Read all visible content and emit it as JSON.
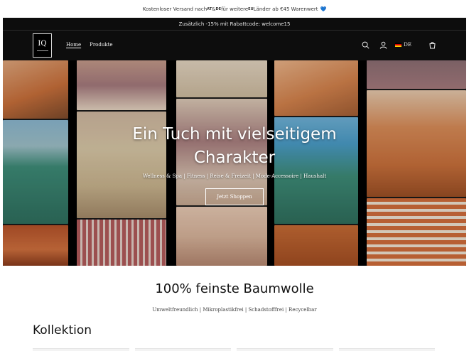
{
  "announcement": {
    "text_before": "Kostenloser Versand nach ",
    "country": "AT",
    "amp": " & ",
    "country2": "DE",
    "text_mid": " für weitere ",
    "region": "EU",
    "text_after": " Länder ab €45 Warenwert",
    "emoji": "💙"
  },
  "promo": {
    "text": "Zusätzlich -15% mit Rabattcode: welcome15"
  },
  "header": {
    "logo_text": "IQ",
    "nav": [
      {
        "label": "Home",
        "active": true
      },
      {
        "label": "Produkte",
        "active": false
      }
    ],
    "locale": "DE",
    "icons": [
      "search-icon",
      "account-icon",
      "flag-de-icon",
      "cart-icon"
    ]
  },
  "hero": {
    "title_line1": "Ein Tuch mit vielseitigem",
    "title_line2": "Charakter",
    "subtitle": "Wellness & Spa | Fitness | Reise & Freizeit | Mode-Accessoire | Haushalt",
    "button": "Jetzt Shoppen"
  },
  "section": {
    "title": "100% feinste Baumwolle",
    "subtitle": "Umweltfreundlich | Mikroplastikfrei | Schadstofffrei | Recycelbar"
  },
  "collection": {
    "title": "Kollektion"
  },
  "colors": {
    "frame": "#0d0d0d",
    "text": "#121212",
    "orange": "#c9703b",
    "teal": "#3e8c78",
    "sand": "#d8c7a6",
    "mauve": "#a57a7d"
  }
}
